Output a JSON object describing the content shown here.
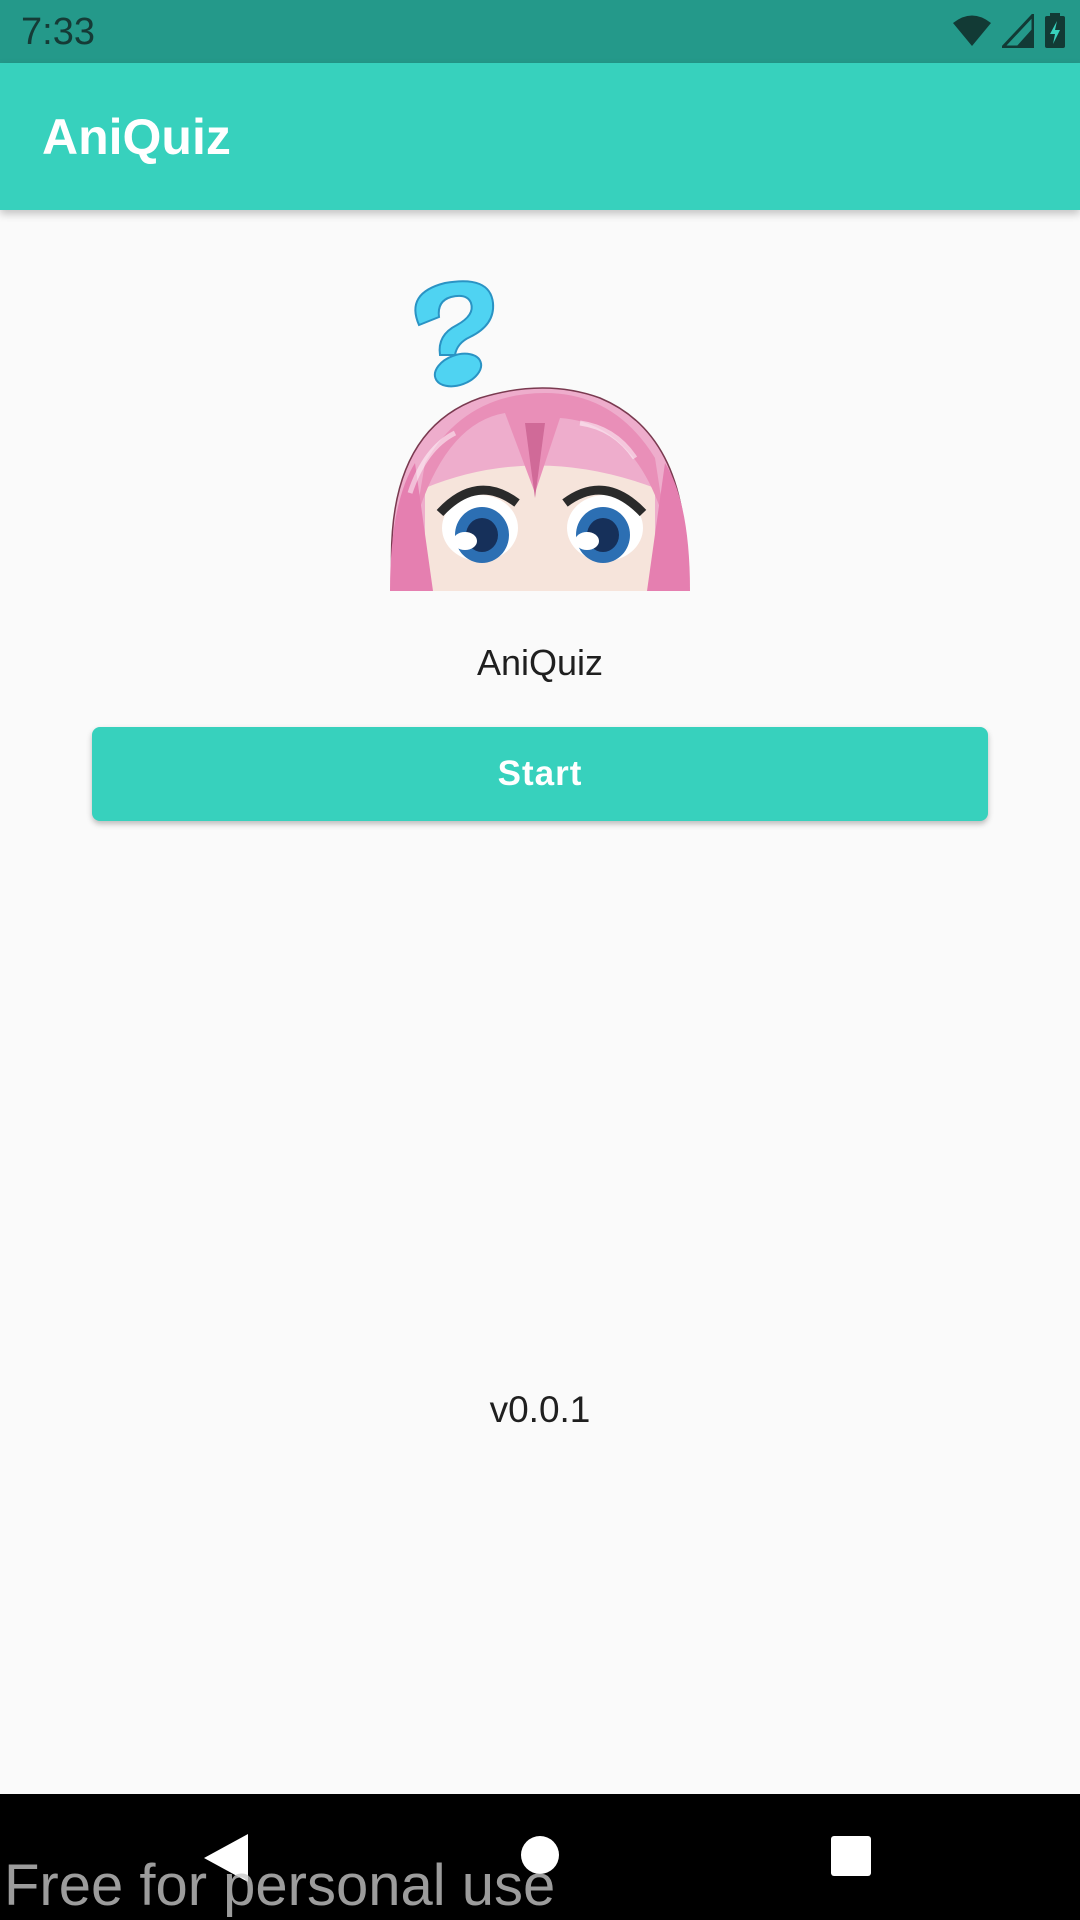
{
  "status_bar": {
    "time": "7:33",
    "icons": [
      "wifi-icon",
      "cellular-signal-icon",
      "battery-charging-icon"
    ]
  },
  "app_bar": {
    "title": "AniQuiz"
  },
  "home": {
    "image": "anime-girl-question-mark-mascot",
    "title": "AniQuiz",
    "start_label": "Start",
    "version": "v0.0.1"
  },
  "nav_bar": {
    "icons": [
      "back-icon",
      "home-icon",
      "recents-icon"
    ]
  },
  "watermark": "Free for personal use",
  "colors": {
    "accent": "#37d1bd",
    "status_bar": "#24998a",
    "background": "#fafafa"
  }
}
